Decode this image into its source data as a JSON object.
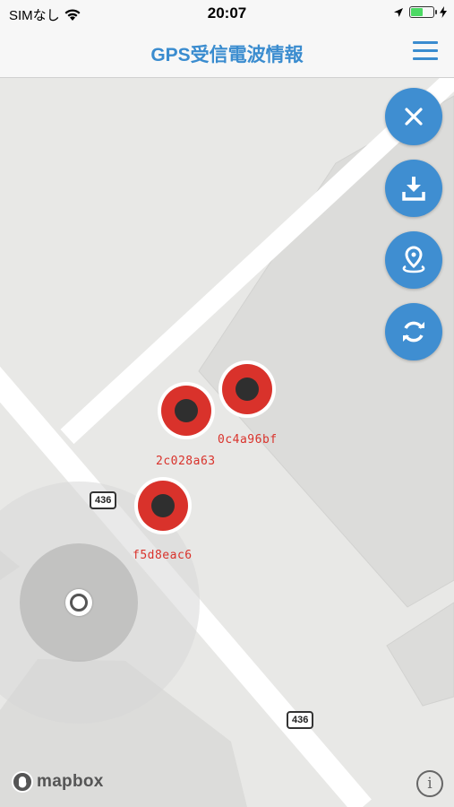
{
  "status_bar": {
    "carrier": "SIMなし",
    "time": "20:07",
    "battery_level": 0.55,
    "battery_color": "#4cd964"
  },
  "header": {
    "title": "GPS受信電波情報",
    "menu_icon": "hamburger-menu-icon"
  },
  "map_controls": [
    {
      "name": "close-button",
      "icon": "close-icon"
    },
    {
      "name": "download-button",
      "icon": "download-icon"
    },
    {
      "name": "location-pin-button",
      "icon": "location-pin-icon"
    },
    {
      "name": "refresh-button",
      "icon": "refresh-icon"
    }
  ],
  "markers": [
    {
      "id": "0c4a96bf"
    },
    {
      "id": "2c028a63"
    },
    {
      "id": "f5d8eac6"
    }
  ],
  "road_labels": [
    "436",
    "436"
  ],
  "attribution": {
    "brand": "mapbox",
    "info": "i"
  },
  "colors": {
    "accent": "#3f8ed1",
    "marker_red": "#d9322b",
    "title_blue": "#3a8ccf"
  }
}
